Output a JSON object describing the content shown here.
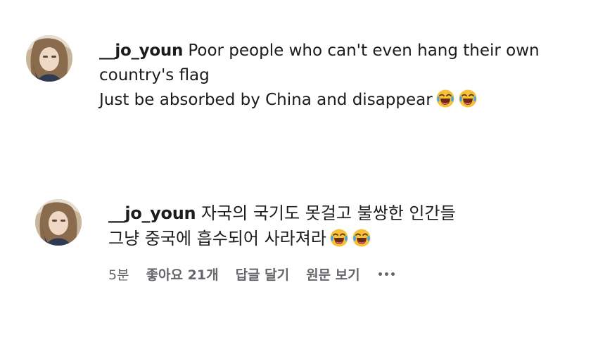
{
  "comments": [
    {
      "username": "__jo_youn",
      "lines": [
        " Poor people who can't even hang their own country's flag",
        "Just be absorbed by China and disappear"
      ],
      "emoji": [
        "laughing-face-emoji",
        "laughing-face-emoji"
      ]
    },
    {
      "username": "__jo_youn",
      "lines": [
        " 자국의 국기도 못걸고 불쌍한 인간들",
        "그냥 중국에 흡수되어 사라져라"
      ],
      "emoji": [
        "laughing-face-emoji",
        "laughing-face-emoji"
      ],
      "actions": {
        "time": "5분",
        "like": "좋아요 21개",
        "reply": "답글 달기",
        "see_original": "원문 보기"
      }
    }
  ],
  "colors": {
    "text": "#1c1c1c",
    "secondary": "#65676b",
    "emoji_face": "#f7c23a",
    "emoji_tear": "#4aa3e8"
  }
}
